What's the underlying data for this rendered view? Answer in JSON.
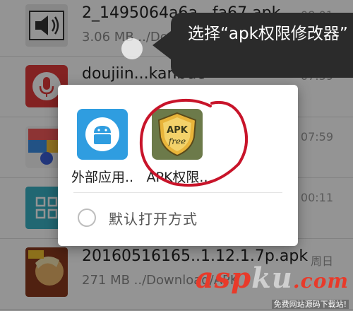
{
  "file_list": {
    "rows": [
      {
        "name": "2_1495064a6a...fa67.apk",
        "meta": "3.06 MB  ../Download/...",
        "time": "08:01"
      },
      {
        "name": "doujiin...kanbuc",
        "meta": "",
        "time": "07:59"
      },
      {
        "name": "",
        "meta": "",
        "time": "07:59"
      },
      {
        "name": "",
        "meta": "",
        "time": "00:11"
      },
      {
        "name": "20160516165..1.12.1.7p.apk",
        "meta": "271 MB  ../Download/APK",
        "time": "周日"
      }
    ]
  },
  "dialog": {
    "apps": [
      {
        "label": "外部应用..",
        "icon": "android-app-icon",
        "color": "#2f9de0"
      },
      {
        "label": "APK权限..",
        "icon": "apk-free-shield-icon",
        "color": "#6c7a4a"
      }
    ],
    "default_label": "默认打开方式"
  },
  "tooltip": {
    "text": "选择“apk权限修改器”"
  },
  "watermark": {
    "brand_a": "asp",
    "brand_b": "ku",
    "brand_c": ".com",
    "tag": "免费网站源码下载站!"
  },
  "colors": {
    "accent": "#2f9de0",
    "dim": "rgba(0,0,0,0.42)",
    "tooltip": "#2b2b2b",
    "watermark": "#e83a2a"
  }
}
